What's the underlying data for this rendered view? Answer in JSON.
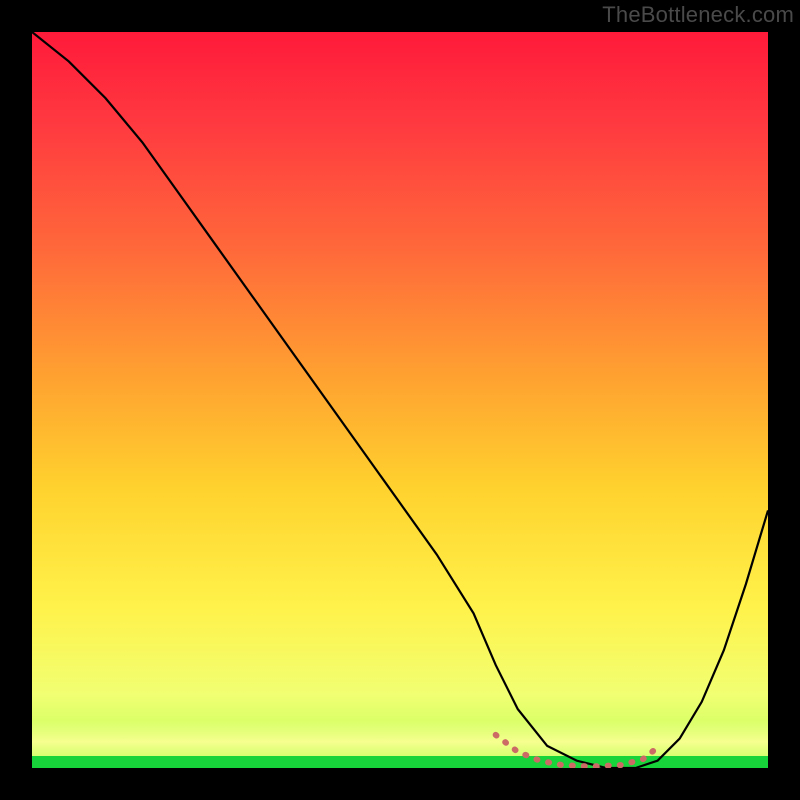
{
  "watermark": "TheBottleneck.com",
  "chart_data": {
    "type": "line",
    "title": "",
    "xlabel": "",
    "ylabel": "",
    "xlim": [
      0,
      100
    ],
    "ylim": [
      0,
      100
    ],
    "grid": false,
    "legend": false,
    "gradient_stops": [
      {
        "offset": 0,
        "color": "#ff1a3a"
      },
      {
        "offset": 12,
        "color": "#ff3840"
      },
      {
        "offset": 30,
        "color": "#ff6a3a"
      },
      {
        "offset": 48,
        "color": "#ffa530"
      },
      {
        "offset": 62,
        "color": "#ffd22e"
      },
      {
        "offset": 78,
        "color": "#fff24a"
      },
      {
        "offset": 90,
        "color": "#f1ff72"
      },
      {
        "offset": 97,
        "color": "#c7ff5e"
      },
      {
        "offset": 100,
        "color": "#17d43a"
      }
    ],
    "series": [
      {
        "name": "bottleneck-curve",
        "stroke": "#000000",
        "width": 2.2,
        "x": [
          0,
          5,
          10,
          15,
          20,
          25,
          30,
          35,
          40,
          45,
          50,
          55,
          60,
          63,
          66,
          70,
          74,
          78,
          82,
          85,
          88,
          91,
          94,
          97,
          100
        ],
        "y": [
          100,
          96,
          91,
          85,
          78,
          71,
          64,
          57,
          50,
          43,
          36,
          29,
          21,
          14,
          8,
          3,
          1,
          0,
          0,
          1,
          4,
          9,
          16,
          25,
          35
        ]
      },
      {
        "name": "flat-marker",
        "stroke": "#cc6a66",
        "width": 6,
        "linecap": "round",
        "dash": "1 11",
        "x": [
          63,
          66,
          69,
          72,
          76,
          80,
          83,
          85
        ],
        "y": [
          4.5,
          2.2,
          1.0,
          0.4,
          0.2,
          0.4,
          1.2,
          2.8
        ]
      }
    ]
  }
}
